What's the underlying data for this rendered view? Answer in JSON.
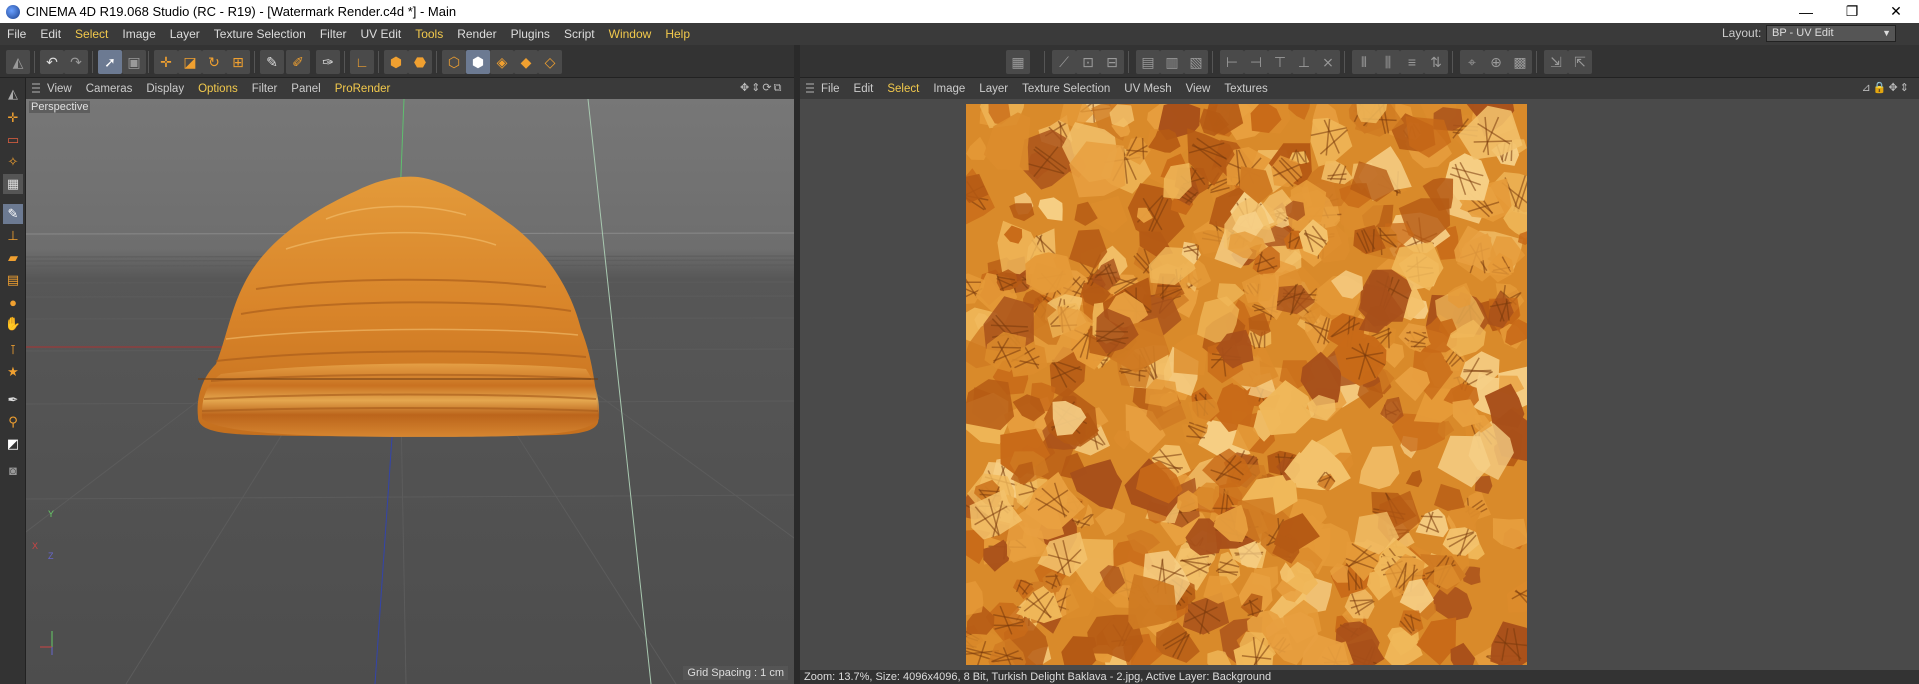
{
  "window": {
    "title": "CINEMA 4D R19.068 Studio (RC - R19) - [Watermark Render.c4d *] - Main",
    "controls": {
      "minimize": "—",
      "maximize": "❐",
      "close": "✕"
    }
  },
  "menubar": {
    "items": [
      "File",
      "Edit",
      "Select",
      "Image",
      "Layer",
      "Texture Selection",
      "Filter",
      "UV Edit",
      "Tools",
      "Render",
      "Plugins",
      "Script",
      "Window",
      "Help"
    ],
    "highlighted": [
      "Select",
      "Tools",
      "Window",
      "Help"
    ],
    "layout_label": "Layout:",
    "layout_value": "BP - UV Edit"
  },
  "viewport": {
    "menu": [
      "View",
      "Cameras",
      "Display",
      "Options",
      "Filter",
      "Panel",
      "ProRender"
    ],
    "highlighted": [
      "Options",
      "ProRender"
    ],
    "label": "Perspective",
    "grid_spacing": "Grid Spacing : 1 cm",
    "axis_labels": {
      "x": "X",
      "y": "Y",
      "z": "Z"
    }
  },
  "uv_editor": {
    "menu": [
      "File",
      "Edit",
      "Select",
      "Image",
      "Layer",
      "Texture Selection",
      "UV Mesh",
      "View",
      "Textures"
    ],
    "highlighted": [
      "Select"
    ],
    "status": "Zoom: 13.7%, Size: 4096x4096, 8 Bit, Turkish Delight Baklava - 2.jpg, Active Layer: Background"
  },
  "colors": {
    "accent": "#f2c94c",
    "icon_orange": "#f0a030",
    "active_tool": "#6c7a92",
    "panel_bg": "#333333"
  }
}
